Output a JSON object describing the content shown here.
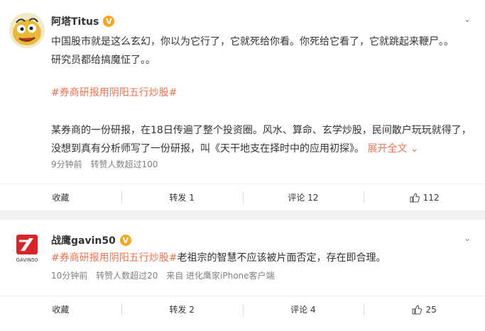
{
  "posts": [
    {
      "author": "阿塔Titus",
      "verified_badge": "V",
      "lines": [
        "中国股市就是这么玄幻，你以为它行了，它就死给你看。你死给它看了，它就跳起来鞭尸。。",
        "研究员都给搞魔怔了。。"
      ],
      "hashtag": "#券商研报用阴阳五行炒股#",
      "body_lines": [
        "某券商的一份研报，在18日传遍了整个投资圈。风水、算命、玄学炒股，民间散户玩玩就得了，",
        "没想到真有分析师写了一份研报，叫《天干地支在择时中的应用初探》。"
      ],
      "expand_label": "展开全文",
      "time": "9分钟前",
      "reposts_note": "转赞人数超过100",
      "actions": {
        "favorite": "收藏",
        "repost": "转发 1",
        "comment": "评论 12",
        "like": "112"
      }
    },
    {
      "author": "战鹰gavin50",
      "verified_badge": "V",
      "avatar_text": "GAVIN50",
      "hashtag": "#券商研报用阴阳五行炒股#",
      "text_after_hashtag": "老祖宗的智慧不应该被片面否定，存在即合理。",
      "time": "10分钟前",
      "reposts_note": "转赞人数超过20",
      "source": "来自 进化鹰家iPhone客户端",
      "actions": {
        "favorite": "收藏",
        "repost": "转发 2",
        "comment": "评论 4",
        "like": "25"
      }
    }
  ],
  "colors": {
    "accent": "#eb7350",
    "badge": "#f5a623",
    "meta_gray": "#808080",
    "background": "#f2f2f5"
  },
  "icons": [
    "chevron-down-icon",
    "verified-badge-icon",
    "thumb-up-icon",
    "expand-chevron-icon"
  ]
}
